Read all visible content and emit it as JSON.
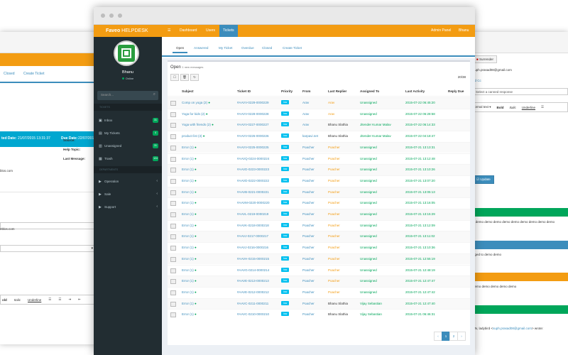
{
  "colors": {
    "orange": "#f39c12",
    "blue": "#3c8dbc",
    "sidebar": "#222d32",
    "green": "#00a65a",
    "cyan": "#00c0ef"
  },
  "brand": {
    "name": "Faveo",
    "suffix": " HELPDESK"
  },
  "topnav": {
    "menu_icon": "☰",
    "items": [
      "Dashboard",
      "Users",
      "Tickets"
    ],
    "admin": "Admin Panel",
    "user": "Bhanu"
  },
  "sidebar": {
    "username": "Bhanu",
    "status": "Online",
    "search_placeholder": "Search...",
    "tickets_heading": "TICKETS",
    "ticket_items": [
      {
        "label": "Inbox",
        "badge": "31",
        "icon": "▣"
      },
      {
        "label": "My Tickets",
        "badge": "4",
        "icon": "▤"
      },
      {
        "label": "Unassigned",
        "badge": "31",
        "icon": "▥"
      },
      {
        "label": "Trash",
        "badge": "124",
        "icon": "▦"
      }
    ],
    "departments_heading": "DEPARTMENTS",
    "departments": [
      {
        "label": "Operation",
        "icon": "▶"
      },
      {
        "label": "Sale",
        "icon": "▶"
      },
      {
        "label": "Support",
        "icon": "▶"
      }
    ]
  },
  "subtabs": [
    "Open",
    "Answered",
    "My Ticket",
    "Overdue",
    "Closed",
    "Create Ticket"
  ],
  "box": {
    "title": "Open",
    "subtitle": "1 new messages",
    "count": "20/38"
  },
  "toolbar_icons": [
    "☐",
    "🗑",
    "↻"
  ],
  "columns": [
    "Subject",
    "Ticket ID",
    "Priority",
    "From",
    "Last Replier",
    "Assigned To",
    "Last Activity",
    "Reply Due"
  ],
  "rows": [
    {
      "subject": "Comp on yoga (2)",
      "id": "#AAVV-0229-0000229",
      "priority": "low",
      "from": "Arav",
      "replier": "Arav",
      "assigned": "Unassigned",
      "activity": "2015-07-22 06:45:20"
    },
    {
      "subject": "Yoga for kids (2)",
      "id": "#AAVV-0228-0000228",
      "priority": "low",
      "from": "Arav",
      "replier": "Arav",
      "assigned": "Unassigned",
      "activity": "2015-07-22 06:28:58"
    },
    {
      "subject": "Yoga with friends (2)",
      "id": "#AAVV-0227-0000227",
      "priority": "low",
      "from": "Arav",
      "replier": "Bhanu Slathia",
      "assigned": "Jitender Kumar Malav",
      "activity": "2015-07-22 06:14:33"
    },
    {
      "subject": "product list (3)",
      "id": "#AAVV-0226-0000226",
      "priority": "low",
      "from": "karpavi.net",
      "replier": "Bhanu Slathia",
      "assigned": "Jitender Kumar Malav",
      "activity": "2015-07-22 04:18:47"
    },
    {
      "subject": "Error (1)",
      "id": "#AAVV-0225-0000225",
      "priority": "low",
      "from": "Poacher",
      "replier": "Poacher",
      "assigned": "Unassigned",
      "activity": "2015-07-21 13:13:31"
    },
    {
      "subject": "Error (1)",
      "id": "#AAVQ-0224-0000224",
      "priority": "low",
      "from": "Poacher",
      "replier": "Poacher",
      "assigned": "Unassigned",
      "activity": "2015-07-21 13:12:48"
    },
    {
      "subject": "Error (1)",
      "id": "#AAVD-0223-0000223",
      "priority": "low",
      "from": "Poacher",
      "replier": "Poacher",
      "assigned": "Unassigned",
      "activity": "2015-07-21 13:10:26"
    },
    {
      "subject": "Error (1)",
      "id": "#AAVD-0222-0000222",
      "priority": "low",
      "from": "Poacher",
      "replier": "Poacher",
      "assigned": "Unassigned",
      "activity": "2015-07-21 13:07:20"
    },
    {
      "subject": "Error (1)",
      "id": "#AAVB-0221-0000221",
      "priority": "low",
      "from": "Poacher",
      "replier": "Poacher",
      "assigned": "Unassigned",
      "activity": "2015-07-21 13:05:13"
    },
    {
      "subject": "Error (1)",
      "id": "#AAVM-0220-0000220",
      "priority": "low",
      "from": "Poacher",
      "replier": "Poacher",
      "assigned": "Unassigned",
      "activity": "2015-07-21 13:16:05"
    },
    {
      "subject": "Error (1)",
      "id": "#AAVL-0219-0000219",
      "priority": "low",
      "from": "Poacher",
      "replier": "Poacher",
      "assigned": "Unassigned",
      "activity": "2015-07-21 13:15:29"
    },
    {
      "subject": "Error (1)",
      "id": "#AAVK-0218-0000218",
      "priority": "low",
      "from": "Poacher",
      "replier": "Poacher",
      "assigned": "Unassigned",
      "activity": "2015-07-21 13:12:09"
    },
    {
      "subject": "Error (1)",
      "id": "#AAVJ-0217-0000217",
      "priority": "low",
      "from": "Poacher",
      "replier": "Poacher",
      "assigned": "Unassigned",
      "activity": "2015-07-21 13:11:02"
    },
    {
      "subject": "Error (1)",
      "id": "#AAVJ-0216-0000216",
      "priority": "low",
      "from": "Poacher",
      "replier": "Poacher",
      "assigned": "Unassigned",
      "activity": "2015-07-21 13:10:36"
    },
    {
      "subject": "Error (1)",
      "id": "#AAVH-0215-0000215",
      "priority": "low",
      "from": "Poacher",
      "replier": "Poacher",
      "assigned": "Unassigned",
      "activity": "2015-07-21 12:55:19"
    },
    {
      "subject": "Error (1)",
      "id": "#AAVG-0214-0000214",
      "priority": "low",
      "from": "Poacher",
      "replier": "Poacher",
      "assigned": "Unassigned",
      "activity": "2015-07-21 12:48:19"
    },
    {
      "subject": "Error (1)",
      "id": "#AAVE-0213-0000213",
      "priority": "low",
      "from": "Poacher",
      "replier": "Poacher",
      "assigned": "Unassigned",
      "activity": "2015-07-21 12:47:47"
    },
    {
      "subject": "Error (1)",
      "id": "#AAVE-0212-0000212",
      "priority": "low",
      "from": "Poacher",
      "replier": "Poacher",
      "assigned": "Unassigned",
      "activity": "2015-07-21 12:47:42"
    },
    {
      "subject": "Error (1)",
      "id": "#AAVC-0211-0000211",
      "priority": "low",
      "from": "Poacher",
      "replier": "Bhanu Slathia",
      "assigned": "Vijay Sebastian",
      "activity": "2015-07-21 12:47:40"
    },
    {
      "subject": "Error (1)",
      "id": "#AAVC-0210-0000210",
      "priority": "low",
      "from": "Poacher",
      "replier": "Bhanu Slathia",
      "assigned": "Vijay Sebastian",
      "activity": "2015-07-21 06:46:31"
    }
  ],
  "pagination": [
    "‹",
    "1",
    "2",
    "›"
  ],
  "bg_left": {
    "tabs": [
      "Closed",
      "Create Ticket"
    ],
    "created_label": "ted Date:",
    "created": "21/07/2015 13:31:37",
    "due_label": "Due Date:",
    "due": "22/07/2015",
    "source": "Source:",
    "help": "Help Topic:",
    "last": "Last Message:",
    "email1": "blos.com",
    "email2": "eblos.com",
    "fmt": [
      "old",
      "Italic",
      "Underline"
    ]
  },
  "bg_right": {
    "surrender": "Surrender",
    "email": "suph.prasad08@gmail.com",
    "cc": "dd Cc",
    "canned": "Select a canned response",
    "fmt": [
      "Normal text ▾",
      "Bold",
      "Italic",
      "Underline"
    ],
    "update": "Update",
    "msg1": "o demo demo demo demo demo demo demo demo demo",
    "msg2": "nged to demo demo",
    "msg3": "demo demo demo demo demo",
    "sig": "FN, ladybird",
    "sig_email": "suph.prasad08@gmail.com",
    "sig_end": "wrote:"
  }
}
